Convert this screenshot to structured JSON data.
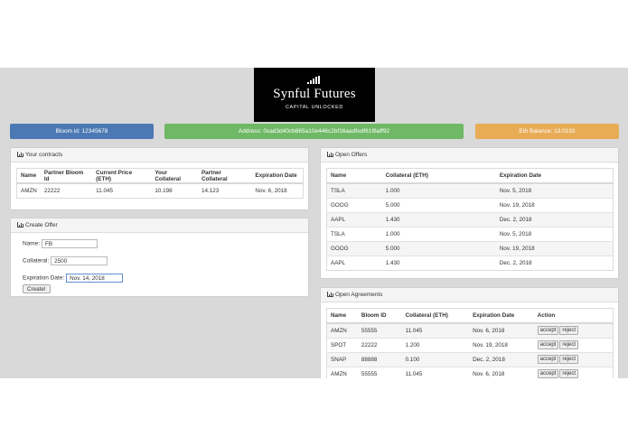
{
  "brand": {
    "title": "Synful Futures",
    "subtitle": "CAPITAL UNLOCKED",
    "icon": "signal-bars-icon"
  },
  "status": {
    "bloom": "Bloom id: 12345678",
    "address": "Address: 0xad3d40cb865a10e446c2bf16aadfedf61f8aff92",
    "balance": "Eth Balance: 13.0192",
    "colors": {
      "bloom": "#4c79b3",
      "address": "#6fb866",
      "balance": "#e8ac57"
    }
  },
  "contracts": {
    "title": "Your contracts",
    "columns": [
      "Name",
      "Partner Bloom Id",
      "Current Price (ETH)",
      "Your Collateral",
      "Partner Collateral",
      "Expiration Date"
    ],
    "rows": [
      [
        "AMZN",
        "22222",
        "11.045",
        "10.198",
        "14.123",
        "Nov. 6, 2018"
      ]
    ]
  },
  "create_offer": {
    "title": "Create Offer",
    "name_label": "Name:",
    "name_value": "FB",
    "collateral_label": "Collateral:",
    "collateral_value": "2500",
    "expiration_label": "Expiration Date:",
    "expiration_value": "Nov. 14, 2018",
    "button": "Create!"
  },
  "open_offers": {
    "title": "Open Offers",
    "columns": [
      "Name",
      "Collateral (ETH)",
      "Expiration Date"
    ],
    "rows": [
      [
        "TSLA",
        "1.000",
        "Nov. 5, 2018"
      ],
      [
        "GOOG",
        "5.000",
        "Nov. 19, 2018"
      ],
      [
        "AAPL",
        "1.430",
        "Dec. 2, 2018"
      ],
      [
        "TSLA",
        "1.000",
        "Nov. 5, 2018"
      ],
      [
        "GOOG",
        "5.000",
        "Nov. 19, 2018"
      ],
      [
        "AAPL",
        "1.430",
        "Dec. 2, 2018"
      ]
    ]
  },
  "open_agreements": {
    "title": "Open Agreements",
    "columns": [
      "Name",
      "Bloom ID",
      "Collateral (ETH)",
      "Expiration Date",
      "Action"
    ],
    "accept_label": "accept",
    "reject_label": "reject",
    "rows": [
      [
        "AMZN",
        "55555",
        "11.045",
        "Nov. 6, 2018"
      ],
      [
        "SPOT",
        "22222",
        "1.200",
        "Nov. 19, 2018"
      ],
      [
        "SNAP",
        "88888",
        "0.100",
        "Dec. 2, 2018"
      ],
      [
        "AMZN",
        "55555",
        "11.045",
        "Nov. 6, 2018"
      ]
    ]
  }
}
